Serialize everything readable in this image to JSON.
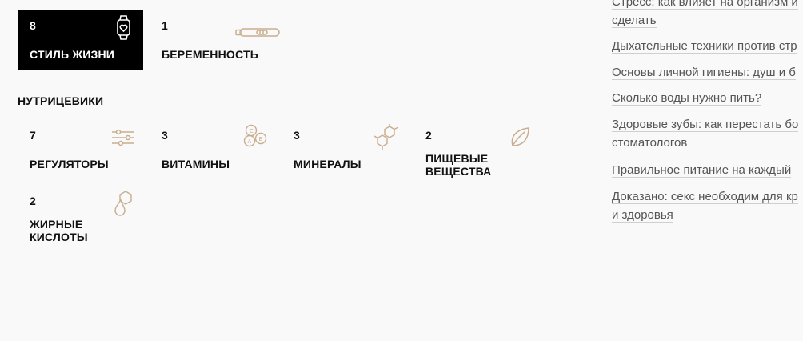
{
  "categories": [
    {
      "count": "8",
      "label": "Стиль жизни",
      "icon": "smartwatch-heart-icon",
      "active": true
    },
    {
      "count": "1",
      "label": "Беременность",
      "icon": "pregnancy-test-icon",
      "active": false
    }
  ],
  "nutrients_section": {
    "title": "НУТРИЦЕВИКИ",
    "items": [
      {
        "count": "7",
        "label": "Регуляторы",
        "icon": "sliders-icon"
      },
      {
        "count": "3",
        "label": "Витамины",
        "icon": "vitamins-abc-icon"
      },
      {
        "count": "3",
        "label": "Минералы",
        "icon": "molecule-icon"
      },
      {
        "count": "2",
        "label_line1": "Пищевые",
        "label_line2": "вещества",
        "icon": "leaf-icon"
      },
      {
        "count": "2",
        "label_line1": "Жирные",
        "label_line2": "кислоты",
        "icon": "oil-drop-icon"
      }
    ]
  },
  "articles": [
    {
      "line1": "Стресс: как влияет на организм и",
      "line2": "сделать"
    },
    {
      "line1": "Дыхательные техники против стр"
    },
    {
      "line1": "Основы личной гигиены: душ и б"
    },
    {
      "line1": "Сколько воды нужно пить?"
    },
    {
      "line1": "Здоровые зубы: как перестать бо",
      "line2": "стоматологов"
    },
    {
      "line1": "Правильное питание на каждый"
    },
    {
      "line1": "Доказано: секс необходим для кр",
      "line2": "и здоровья"
    }
  ],
  "colors": {
    "icon": "#c9ad8f",
    "active_bg": "#000000",
    "page_bg": "#f9f9f9"
  }
}
